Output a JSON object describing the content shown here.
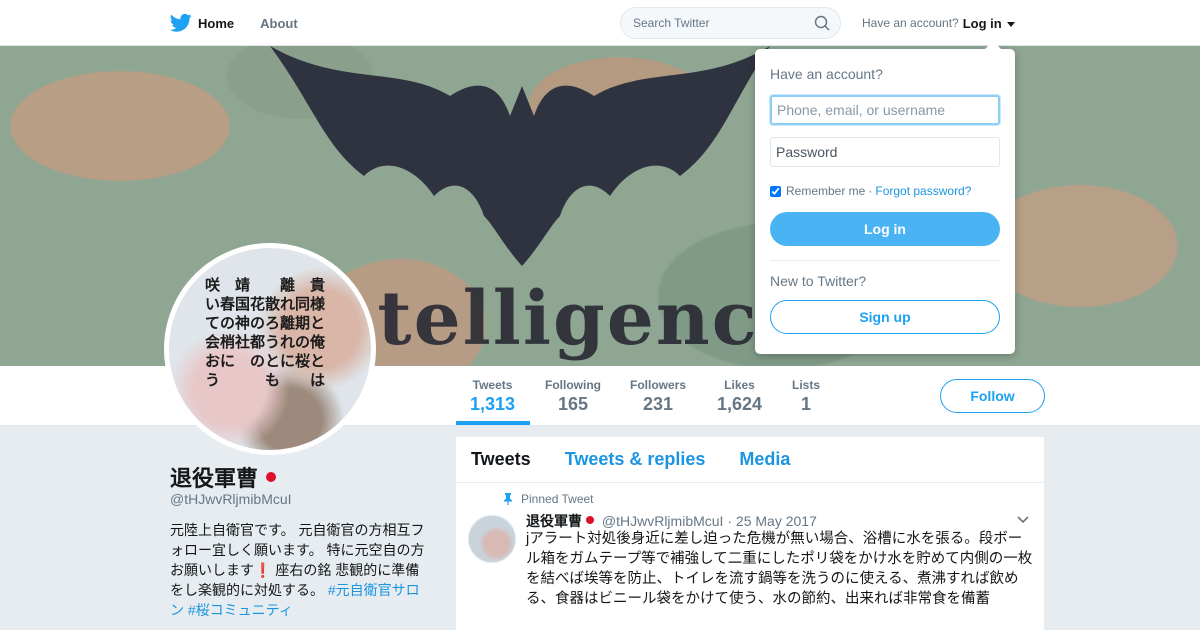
{
  "nav": {
    "home_label": "Home",
    "about_label": "About",
    "search_placeholder": "Search Twitter",
    "have_account": "Have an account?",
    "login_label": "Log in"
  },
  "banner": {
    "text": "Intelligence bat"
  },
  "stats": [
    {
      "label": "Tweets",
      "value": "1,313"
    },
    {
      "label": "Following",
      "value": "165"
    },
    {
      "label": "Followers",
      "value": "231"
    },
    {
      "label": "Likes",
      "value": "1,624"
    },
    {
      "label": "Lists",
      "value": "1"
    }
  ],
  "follow_label": "Follow",
  "avatar": {
    "text": "咲　靖　　離　貴\nい春国花散れ同様\nての神のろ離期と\n会梢社都うれの俺\nおに　のとに桜と\nう　　　も　　は"
  },
  "profile": {
    "name": "退役軍曹",
    "handle": "@tHJwvRljmibMcuI",
    "bio_part1": "元陸上自衛官です。 元自衛官の方相互フォロー宜しく願います。 特に元空自の方お願いします",
    "bio_excl": "❗",
    "bio_part2": " 座右の銘 悲観的に準備をし楽観的に対処する。 ",
    "bio_tag1": "#元自衛官サロン",
    "bio_tag2": "#桜コミュニティ"
  },
  "timeline": {
    "tabs": [
      "Tweets",
      "Tweets & replies",
      "Media"
    ],
    "pinned_label": "Pinned Tweet",
    "tweet": {
      "name": "退役軍曹",
      "handle": "@tHJwvRljmibMcuI",
      "separator": "·",
      "date": "25 May 2017",
      "text": "jアラート対処後身近に差し迫った危機が無い場合、浴槽に水を張る。段ボール箱をガムテープ等で補強して二重にしたポリ袋をかけ水を貯めて内側の一枚を結べば埃等を防止、トイレを流す鍋等を洗うのに使える、煮沸すれば飲める、食器はビニール袋をかけて使う、水の節約、出来れば非常食を備蓄"
    }
  },
  "login_dropdown": {
    "title": "Have an account?",
    "username_placeholder": "Phone, email, or username",
    "password_placeholder": "Password",
    "remember_label": "Remember me",
    "separator": "·",
    "forgot_label": "Forgot password?",
    "login_button": "Log in",
    "new_label": "New to Twitter?",
    "signup_button": "Sign up"
  },
  "colors": {
    "accent": "#1da1f2",
    "link": "#1b95e0",
    "login_button": "#4ab3f4",
    "flag_red": "#e0102d"
  },
  "icons": [
    "twitter-bird-icon",
    "search-icon",
    "caret-down-icon",
    "pin-icon",
    "chevron-down-icon",
    "flag-japan-icon"
  ]
}
